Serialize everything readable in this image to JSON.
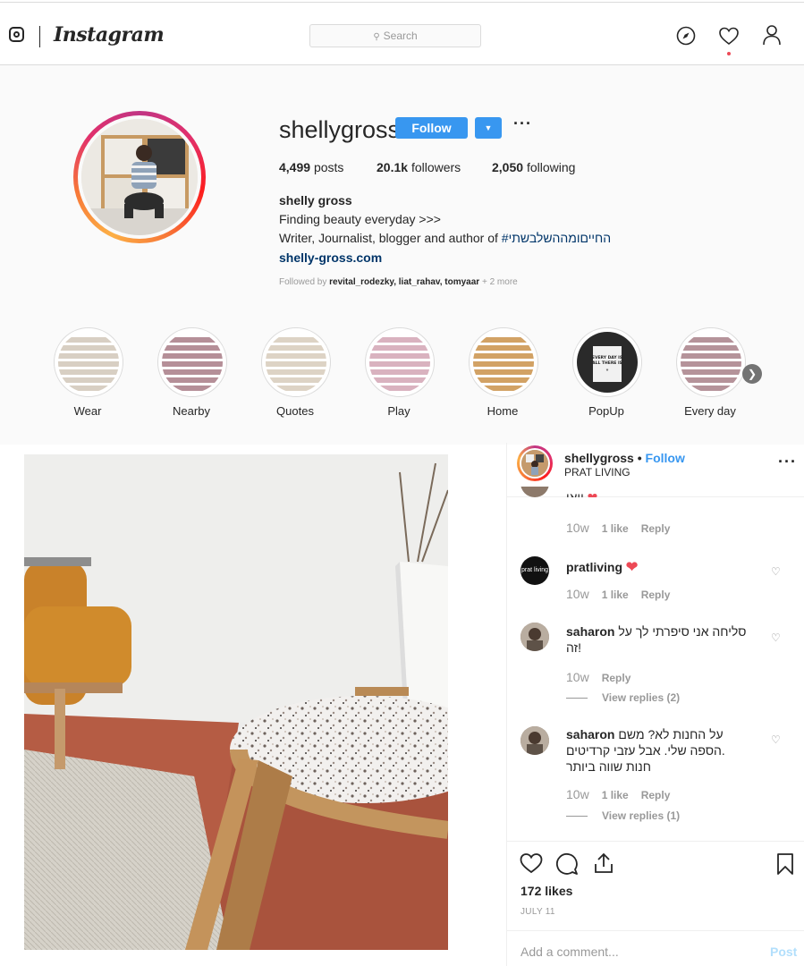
{
  "nav": {
    "logo_text": "Instagram",
    "search_placeholder": "Search",
    "icons": [
      "instagram-camera-icon",
      "explore-compass-icon",
      "activity-heart-icon",
      "profile-person-icon"
    ]
  },
  "profile": {
    "username": "shellygross",
    "follow_label": "Follow",
    "more_label": "···",
    "stats": {
      "posts_count": "4,499",
      "posts_label": "posts",
      "followers_count": "20.1k",
      "followers_label": "followers",
      "following_count": "2,050",
      "following_label": "following"
    },
    "full_name": "shelly gross",
    "bio_line1": "Finding beauty everyday >>>",
    "bio_line2": "Writer, Journalist, blogger and author of",
    "bio_hashtag": "#החייםומההשלבשתי",
    "website": "shelly-gross.com",
    "followed_by_prefix": "Followed by",
    "followed_by_users": "revital_rodezky, liat_rahav, tomyaar",
    "followed_by_more": "+ 2 more"
  },
  "highlights": [
    {
      "label": "Wear",
      "color": "#d8cfc3"
    },
    {
      "label": "Nearby",
      "color": "#b58f98"
    },
    {
      "label": "Quotes",
      "color": "#ddd3c5"
    },
    {
      "label": "Play",
      "color": "#d9b2bf"
    },
    {
      "label": "Home",
      "color": "#d2a265"
    },
    {
      "label": "PopUp",
      "color": "#2b2b2b"
    },
    {
      "label": "Every day",
      "color": "#b5939a"
    }
  ],
  "post": {
    "username": "shellygross",
    "separator": "•",
    "follow_label": "Follow",
    "location": "PRAT LIVING",
    "more_label": "···",
    "partial_comment": "וואו",
    "partial_meta": {
      "time": "10w",
      "likes": "1 like",
      "reply": "Reply"
    },
    "comments": [
      {
        "user": "pratliving",
        "text": "",
        "time": "10w",
        "likes": "1 like",
        "reply": "Reply",
        "view_replies": ""
      },
      {
        "user": "saharon",
        "text_line1": "סליחה אני סיפרתי לך על",
        "text_line2": "זה!",
        "time": "10w",
        "likes": "",
        "reply": "Reply",
        "view_replies": "View replies (2)"
      },
      {
        "user": "saharon",
        "text_line1": "על החנות לא? משם",
        "text_line2": "הספה שלי. אבל עזבי קרדיטים.",
        "text_line3": "חנות שווה ביותר",
        "time": "10w",
        "likes": "1 like",
        "reply": "Reply",
        "view_replies": "View replies (1)"
      }
    ],
    "likes": "172 likes",
    "date": "JULY 11",
    "add_comment_placeholder": "Add a comment...",
    "post_button": "Post",
    "story_image_text": "EVERY DAY IS ALL THERE IS",
    "pratliving_avatar_text": "prat living"
  }
}
